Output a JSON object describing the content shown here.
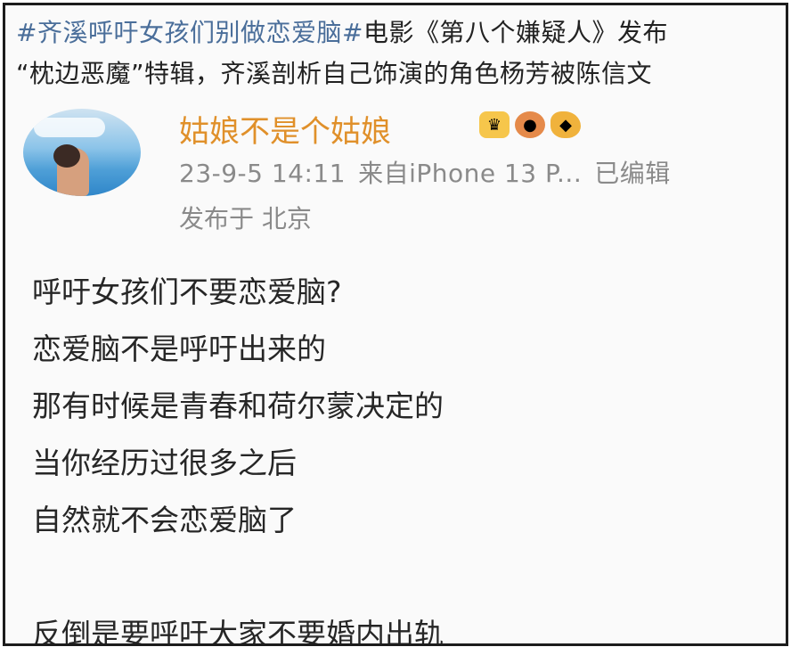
{
  "headline": {
    "topic": "#齐溪呼吁女孩们别做恋爱脑#",
    "line1_rest": "电影《第八个嫌疑人》发布",
    "line2": "“枕边恶魔”特辑，齐溪剖析自己饰演的角色杨芳被陈信文"
  },
  "post": {
    "username": "姑娘不是个姑娘",
    "badges": [
      "crown-badge",
      "bear-badge",
      "fish-badge"
    ],
    "timestamp": "23-9-5 14:11",
    "source": "来自iPhone 13 P...",
    "edited": "已编辑",
    "location": "发布于 北京",
    "lines": [
      "呼吁女孩们不要恋爱脑?",
      "恋爱脑不是呼吁出来的",
      "那有时候是青春和荷尔蒙决定的",
      "当你经历过很多之后",
      "自然就不会恋爱脑了",
      "",
      "反倒是要呼吁大家不要婚内出轨"
    ]
  },
  "colors": {
    "topic": "#4a6e9a",
    "username": "#e0902a",
    "meta": "#8a8a8a",
    "text": "#262626",
    "border": "#1c1c1c"
  }
}
